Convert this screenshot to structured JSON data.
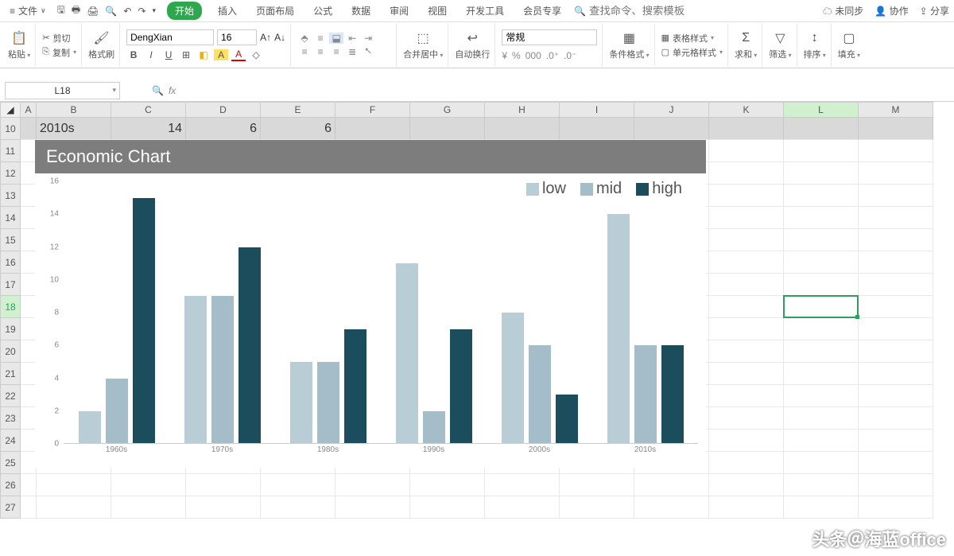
{
  "menubar": {
    "file": "文件",
    "tabs": [
      "开始",
      "插入",
      "页面布局",
      "公式",
      "数据",
      "审阅",
      "视图",
      "开发工具",
      "会员专享"
    ],
    "search_placeholder": "查找命令、搜索模板",
    "right": {
      "unsync": "未同步",
      "coop": "协作",
      "share": "分享"
    }
  },
  "ribbon": {
    "paste": "粘贴",
    "cut": "剪切",
    "copy": "复制",
    "format_painter": "格式刷",
    "font_name": "DengXian",
    "font_size": "16",
    "merge": "合并居中",
    "wrap": "自动换行",
    "number_format": "常规",
    "cond_fmt": "条件格式",
    "table_style": "表格样式",
    "cell_style": "单元格样式",
    "sum": "求和",
    "filter": "筛选",
    "sort": "排序",
    "fill": "填充"
  },
  "namebox": "L18",
  "columns": [
    {
      "l": "A",
      "w": 20
    },
    {
      "l": "B",
      "w": 94
    },
    {
      "l": "C",
      "w": 94
    },
    {
      "l": "D",
      "w": 94
    },
    {
      "l": "E",
      "w": 94
    },
    {
      "l": "F",
      "w": 94
    },
    {
      "l": "G",
      "w": 94
    },
    {
      "l": "H",
      "w": 94
    },
    {
      "l": "I",
      "w": 94
    },
    {
      "l": "J",
      "w": 94
    },
    {
      "l": "K",
      "w": 94
    },
    {
      "l": "L",
      "w": 94
    },
    {
      "l": "M",
      "w": 94
    }
  ],
  "selected_col_index": 11,
  "rows": [
    "10",
    "11",
    "12",
    "13",
    "14",
    "15",
    "16",
    "17",
    "18",
    "19",
    "20",
    "21",
    "22",
    "23",
    "24",
    "25",
    "26",
    "27"
  ],
  "selected_row_index": 8,
  "row10": {
    "B": "2010s",
    "C": "14",
    "D": "6",
    "E": "6"
  },
  "chart_data": {
    "type": "bar",
    "title": "Economic Chart",
    "categories": [
      "1960s",
      "1970s",
      "1980s",
      "1990s",
      "2000s",
      "2010s"
    ],
    "series": [
      {
        "name": "low",
        "color": "#b9cdd6",
        "values": [
          2,
          9,
          5,
          11,
          8,
          14
        ]
      },
      {
        "name": "mid",
        "color": "#a4bdc8",
        "values": [
          4,
          9,
          5,
          2,
          6,
          6
        ]
      },
      {
        "name": "high",
        "color": "#1c4d5c",
        "values": [
          15,
          12,
          7,
          7,
          3,
          6
        ]
      }
    ],
    "ylim": [
      0,
      16
    ],
    "ytick": 2
  },
  "watermark": "头条＠海蓝office"
}
